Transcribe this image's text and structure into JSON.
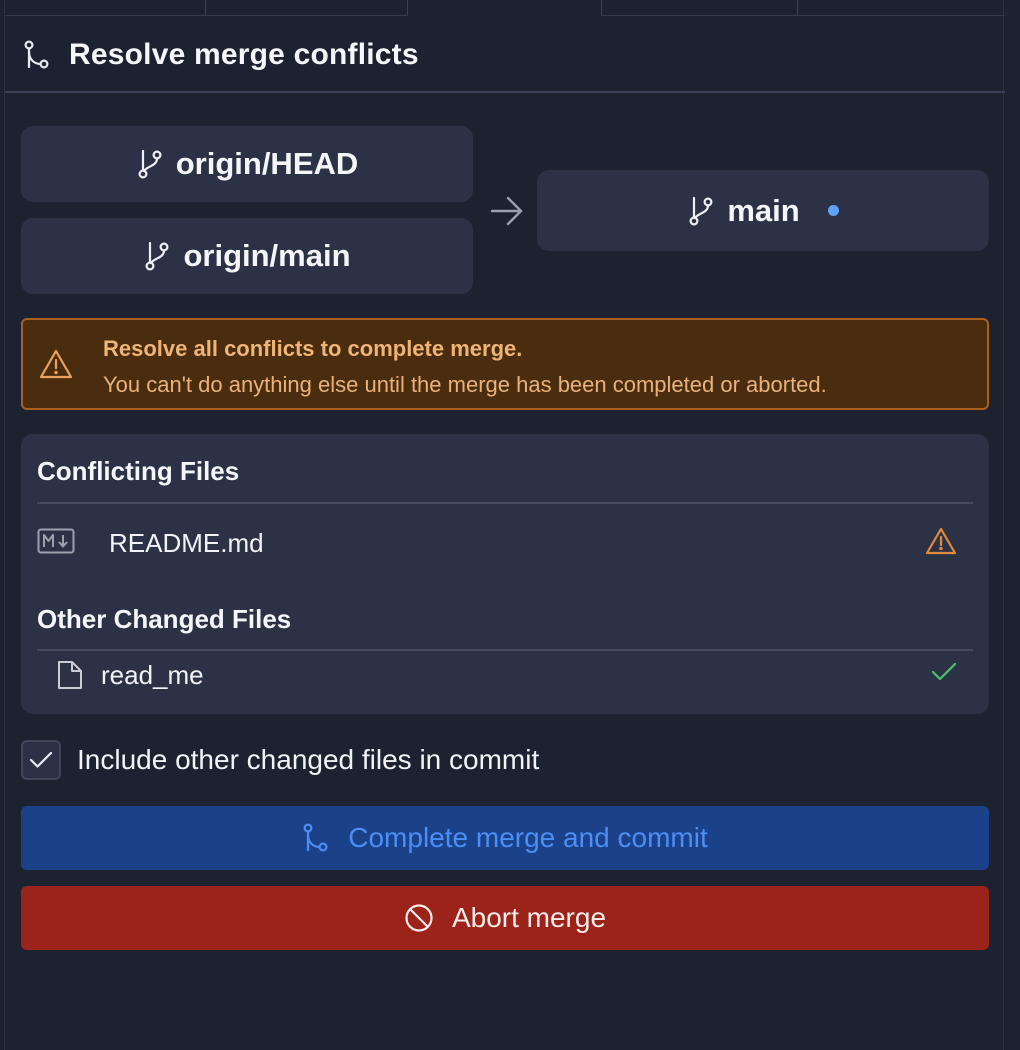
{
  "header": {
    "title": "Resolve merge conflicts",
    "icon": "git-merge-icon"
  },
  "branches": {
    "sources": [
      {
        "label": "origin/HEAD",
        "icon": "git-branch-icon"
      },
      {
        "label": "origin/main",
        "icon": "git-branch-icon"
      }
    ],
    "target": {
      "label": "main",
      "icon": "git-branch-icon",
      "dot_color": "#5ea2f7"
    },
    "arrow_icon": "arrow-right-icon"
  },
  "warning": {
    "icon": "warning-icon",
    "title": "Resolve all conflicts to complete merge.",
    "message": "You can't do anything else until the merge has been completed or aborted."
  },
  "conflicting": {
    "title": "Conflicting Files",
    "files": [
      {
        "name": "README.md",
        "icon": "markdown-icon",
        "status_icon": "warning-icon"
      }
    ]
  },
  "other": {
    "title": "Other Changed Files",
    "files": [
      {
        "name": "read_me",
        "icon": "file-icon",
        "status_icon": "check-icon"
      }
    ]
  },
  "include_checkbox": {
    "label": "Include other changed files in commit",
    "checked": true
  },
  "buttons": {
    "commit": "Complete merge and commit",
    "abort": "Abort merge"
  },
  "colors": {
    "background": "#1d2231",
    "card": "#2c3245",
    "warning_bg": "#4a2d0f",
    "warning_text": "#f0b477",
    "commit_bg": "#1b4289",
    "commit_text": "#4b8ef5",
    "abort_bg": "#9b231a",
    "success": "#4cc36a"
  }
}
